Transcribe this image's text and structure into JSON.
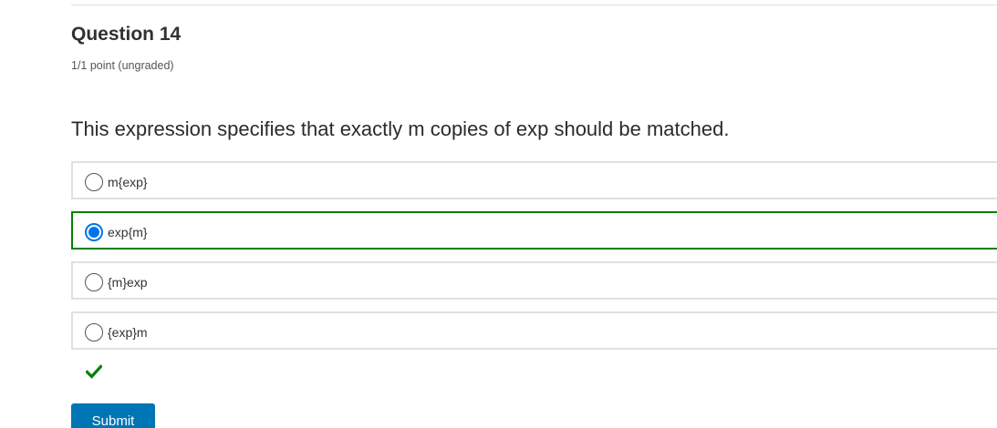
{
  "question": {
    "title": "Question 14",
    "points": "1/1 point (ungraded)",
    "prompt": "This expression specifies that exactly m copies of exp should be matched."
  },
  "choices": [
    {
      "label": "m{exp}",
      "selected": false
    },
    {
      "label": "exp{m}",
      "selected": true
    },
    {
      "label": "{m}exp",
      "selected": false
    },
    {
      "label": "{exp}m",
      "selected": false
    }
  ],
  "result": {
    "icon": "checkmark-icon",
    "color": "#008100"
  },
  "actions": {
    "submit_label": "Submit"
  },
  "colors": {
    "selected_border": "#008100",
    "radio_selected": "#0075eb",
    "submit_bg": "#0075b4"
  }
}
